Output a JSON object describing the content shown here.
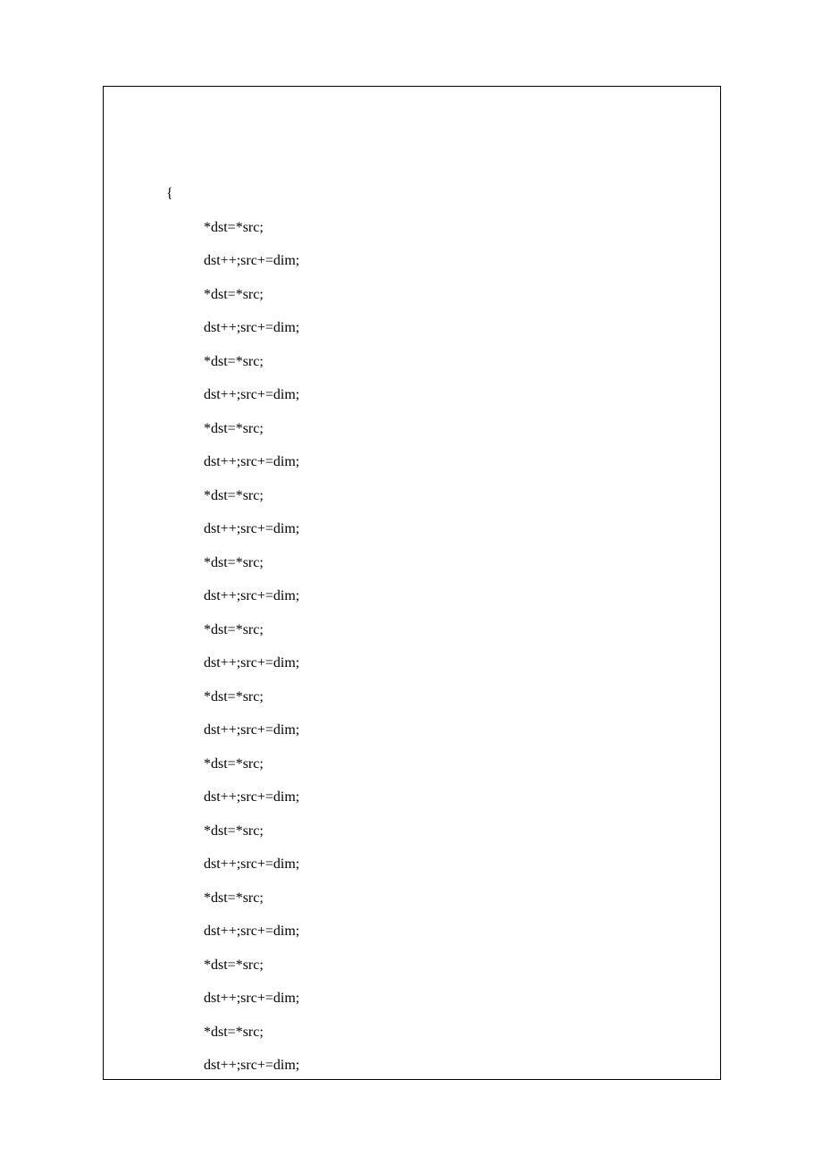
{
  "code": {
    "brace": "{",
    "assign": "*dst=*src;",
    "incr": "dst++;src+=dim;",
    "lines": [
      {
        "type": "brace"
      },
      {
        "type": "assign"
      },
      {
        "type": "incr"
      },
      {
        "type": "assign"
      },
      {
        "type": "incr"
      },
      {
        "type": "assign"
      },
      {
        "type": "incr"
      },
      {
        "type": "assign"
      },
      {
        "type": "incr"
      },
      {
        "type": "assign"
      },
      {
        "type": "incr"
      },
      {
        "type": "assign"
      },
      {
        "type": "incr"
      },
      {
        "type": "assign"
      },
      {
        "type": "incr"
      },
      {
        "type": "assign"
      },
      {
        "type": "incr"
      },
      {
        "type": "assign"
      },
      {
        "type": "incr"
      },
      {
        "type": "assign"
      },
      {
        "type": "incr"
      },
      {
        "type": "assign"
      },
      {
        "type": "incr"
      },
      {
        "type": "assign"
      },
      {
        "type": "incr"
      },
      {
        "type": "assign"
      },
      {
        "type": "incr"
      },
      {
        "type": "assign"
      },
      {
        "type": "incr"
      }
    ]
  }
}
